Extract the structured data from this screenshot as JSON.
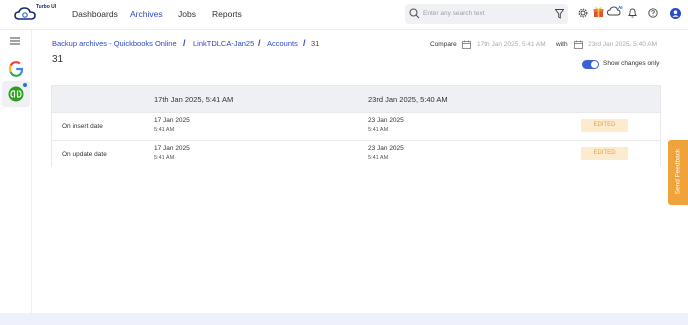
{
  "app": {
    "logo_text": "Turbo UI"
  },
  "nav": {
    "items": [
      "Dashboards",
      "Archives",
      "Jobs",
      "Reports"
    ],
    "active": "Archives"
  },
  "search": {
    "placeholder": "Enter any search text"
  },
  "header_icons": [
    "gear-icon",
    "gift-icon",
    "ai-cloud-icon",
    "bell-icon",
    "help-icon",
    "user-avatar-icon"
  ],
  "sidebar": {
    "items": [
      "menu-icon",
      "google-icon",
      "quickbooks-icon"
    ]
  },
  "breadcrumb": [
    "Backup archives - Quickbooks Online",
    "LinkTDLCA-Jan25",
    "Accounts",
    "31"
  ],
  "breadcrumb_separator": "/",
  "page_title": "31",
  "compare": {
    "label": "Compare",
    "from": "17th Jan 2025, 5:41 AM",
    "with_label": "with",
    "to": "23rd Jan 2025, 5:40 AM"
  },
  "toggle": {
    "label": "Show changes only",
    "on": true
  },
  "table": {
    "headers": [
      "",
      "17th Jan 2025, 5:41 AM",
      "23rd Jan 2025, 5:40 AM",
      ""
    ],
    "rows": [
      {
        "label": "On insert date",
        "left_date": "17 Jan 2025",
        "left_time": "5:41 AM",
        "right_date": "23 Jan 2025",
        "right_time": "5:41 AM",
        "status": "EDITED"
      },
      {
        "label": "On update date",
        "left_date": "17 Jan 2025",
        "left_time": "5:41 AM",
        "right_date": "23 Jan 2025",
        "right_time": "5:41 AM",
        "status": "EDITED"
      }
    ]
  },
  "feedback": {
    "label": "Send Feedback"
  },
  "colors": {
    "accent": "#2c49c8",
    "badge_bg": "#fdebd0",
    "badge_text": "#e8a14a",
    "feedback": "#f0a33a"
  }
}
